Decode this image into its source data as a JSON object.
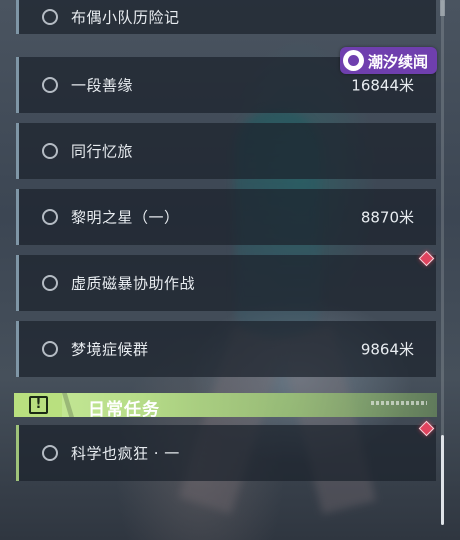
{
  "quests": [
    {
      "name": "布偶小队历险记",
      "distance": ""
    },
    {
      "name": "一段善缘",
      "distance": "16844米"
    },
    {
      "name": "同行忆旅",
      "distance": ""
    },
    {
      "name": "黎明之星（一）",
      "distance": "8870米"
    },
    {
      "name": "虚质磁暴协助作战",
      "distance": ""
    },
    {
      "name": "梦境症候群",
      "distance": "9864米"
    }
  ],
  "section_header": {
    "title": "日常任务",
    "icon": "exclamation-box-icon"
  },
  "daily_quests": [
    {
      "name": "科学也疯狂 · 一",
      "distance": ""
    }
  ],
  "badge": {
    "text": "潮汐续闻",
    "icon": "tide-swirl-icon"
  },
  "colors": {
    "accent_green": "#b9e07f",
    "marker_red": "#e0445f",
    "badge_purple": "#6f3fae"
  }
}
